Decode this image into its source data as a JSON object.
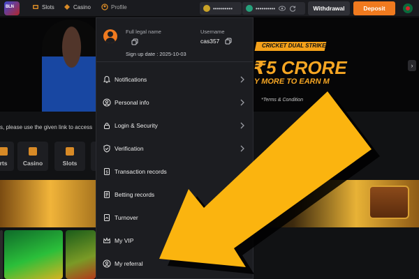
{
  "nav": {
    "items": [
      {
        "label": "Slots",
        "icon": "slots-icon"
      },
      {
        "label": "Casino",
        "icon": "casino-icon"
      },
      {
        "label": "Profile",
        "icon": "profile-icon"
      }
    ],
    "balances": [
      {
        "masked": "••••••••••",
        "coin": "coin-icon",
        "color": "#c9a227"
      },
      {
        "masked": "••••••••••",
        "coin": "tether-icon",
        "color": "#26a17b"
      }
    ],
    "withdraw_label": "Withdrawal",
    "deposit_label": "Deposit",
    "colors": {
      "deposit": "#f07a1f",
      "accent": "#f6a623"
    }
  },
  "banner": {
    "title": "CRICKET DUAL STRIKE",
    "headline": "₹5 CRORE",
    "subline": "Y MORE TO EARN M",
    "terms": "*Terms & Condition"
  },
  "notice": "s, please use the given link to access",
  "categories": [
    {
      "label": "rts"
    },
    {
      "label": "Casino"
    },
    {
      "label": "Slots"
    }
  ],
  "profile_menu": {
    "full_name_label": "Full legal name",
    "full_name_value": "",
    "username_label": "Username",
    "username_value": "cas357",
    "signup_text": "Sign up date : 2025-10-03",
    "items": [
      {
        "label": "Notifications",
        "icon": "bell-icon",
        "has_chevron": true
      },
      {
        "label": "Personal info",
        "icon": "user-icon",
        "has_chevron": true
      },
      {
        "label": "Login & Security",
        "icon": "lock-icon",
        "has_chevron": true
      },
      {
        "label": "Verification",
        "icon": "shield-check-icon",
        "has_chevron": true
      },
      {
        "label": "Transaction records",
        "icon": "receipt-icon",
        "has_chevron": false
      },
      {
        "label": "Betting records",
        "icon": "ticket-icon",
        "has_chevron": false
      },
      {
        "label": "Turnover",
        "icon": "turnover-icon",
        "has_chevron": false
      },
      {
        "label": "My VIP",
        "icon": "crown-icon",
        "has_chevron": true
      },
      {
        "label": "My referral",
        "icon": "referral-icon",
        "has_chevron": true
      }
    ]
  },
  "overlay": {
    "arrow_color": "#fbb40f"
  }
}
